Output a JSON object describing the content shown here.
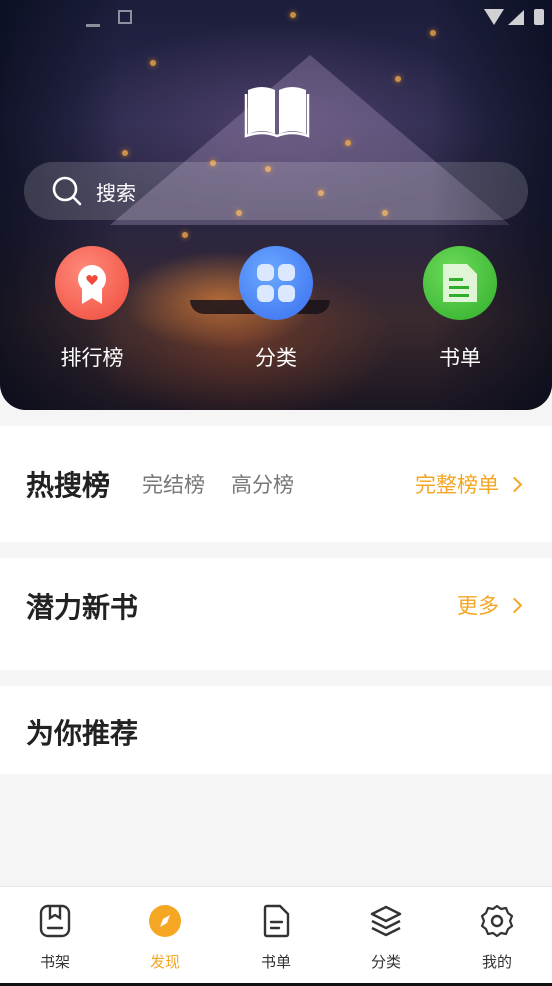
{
  "search": {
    "placeholder": "搜索",
    "icon": "search-icon"
  },
  "shortcuts": [
    {
      "label": "排行榜",
      "icon": "ranking-badge-icon",
      "color": "#ef4a3c"
    },
    {
      "label": "分类",
      "icon": "category-grid-icon",
      "color": "#3a6ff0"
    },
    {
      "label": "书单",
      "icon": "book-list-icon",
      "color": "#2fae2b"
    }
  ],
  "sections": {
    "hot": {
      "title": "热搜榜",
      "tabs": [
        "完结榜",
        "高分榜"
      ],
      "more": "完整榜单"
    },
    "new": {
      "title": "潜力新书",
      "more": "更多"
    },
    "recommend": {
      "title": "为你推荐"
    }
  },
  "bottom_nav": {
    "items": [
      {
        "label": "书架",
        "icon": "bookshelf-icon",
        "active": false
      },
      {
        "label": "发现",
        "icon": "compass-icon",
        "active": true
      },
      {
        "label": "书单",
        "icon": "document-icon",
        "active": false
      },
      {
        "label": "分类",
        "icon": "layers-icon",
        "active": false
      },
      {
        "label": "我的",
        "icon": "gear-icon",
        "active": false
      }
    ]
  },
  "colors": {
    "accent": "#f5a623",
    "background": "#f5f5f5"
  }
}
